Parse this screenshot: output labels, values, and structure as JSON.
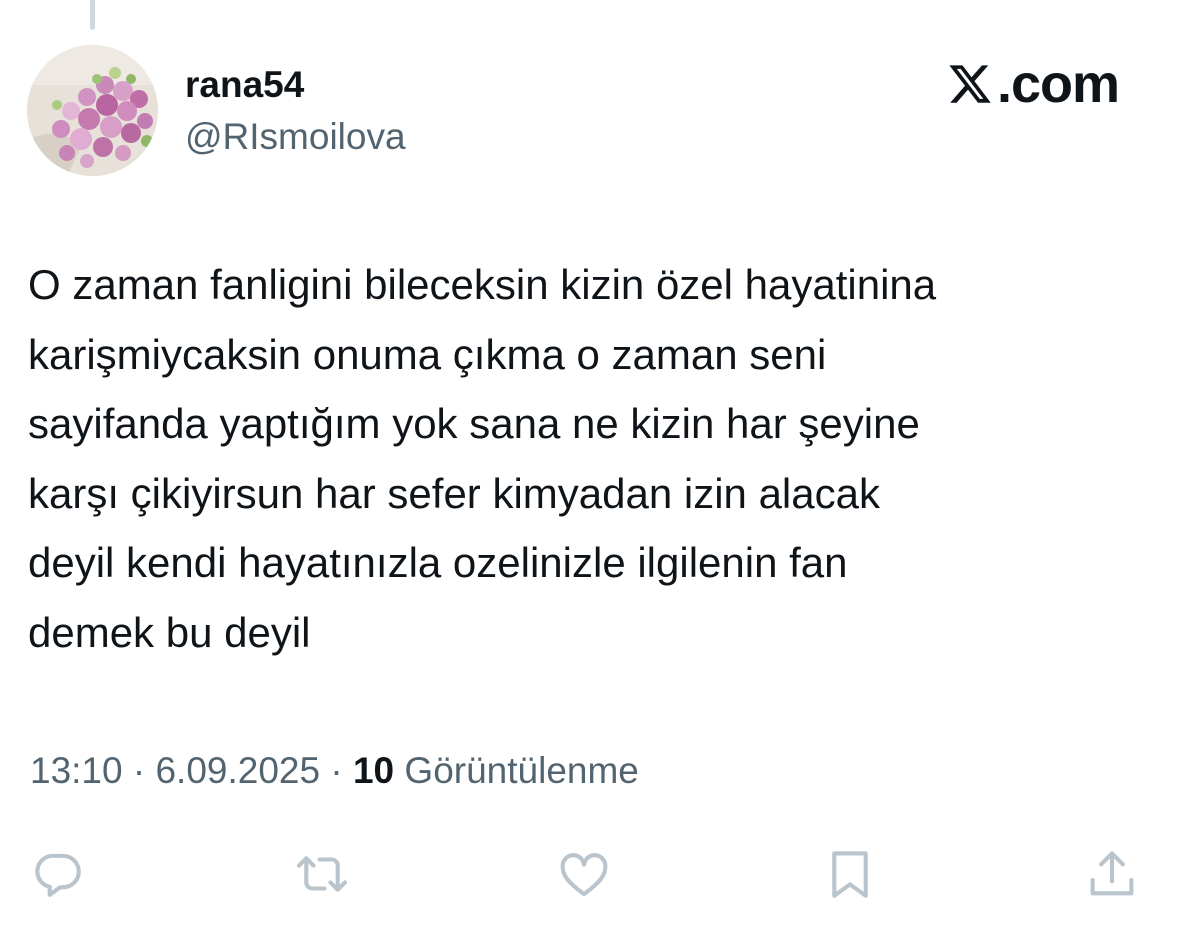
{
  "author": {
    "display_name": "rana54",
    "handle": "@RIsmoilova",
    "avatar_icon": "rose-bouquet-avatar"
  },
  "brand": {
    "label": ".com",
    "icon": "x-logo-icon"
  },
  "tweet": {
    "lines": [
      "O zaman fanligini bileceksin kizin özel hayatinina",
      "karişmiycaksin onuma çıkma o zaman seni",
      "sayifanda yaptığım yok sana ne kizin har şeyine",
      "karşı çikiyirsun har sefer kimyadan izin alacak",
      "deyil kendi hayatınızla ozelinizle ilgilenin fan",
      "demek bu deyil"
    ]
  },
  "meta": {
    "time": "13:10",
    "separator": " · ",
    "date": "6.09.2025",
    "views_count": "10",
    "views_label": " Görüntülenme"
  },
  "actions": {
    "icons": [
      "reply-icon",
      "retweet-icon",
      "like-icon",
      "bookmark-icon",
      "share-icon"
    ],
    "icon_color": "#b9c4cc"
  },
  "colors": {
    "text_primary": "#0f1419",
    "text_secondary": "#536471",
    "thread_line": "#cfd9de"
  }
}
